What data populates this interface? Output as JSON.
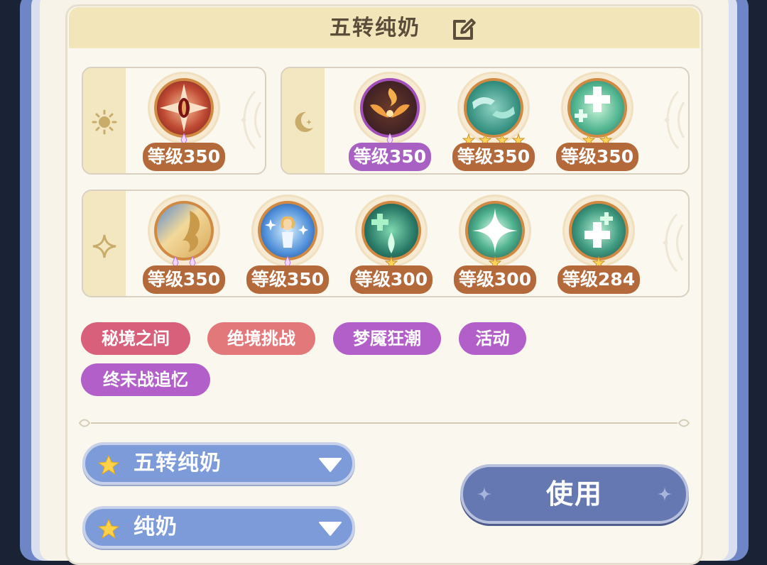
{
  "header": {
    "title": "五转纯奶"
  },
  "rows": [
    {
      "icon": "sun-icon",
      "skills": [
        {
          "name": "red-eye-skill",
          "level": "等级350",
          "style": "orange"
        }
      ]
    },
    {
      "icon": "moon-icon",
      "skills": [
        {
          "name": "flame-wings-skill",
          "level": "等级350",
          "style": "purple"
        },
        {
          "name": "healing-hands-skill",
          "level": "等级350",
          "style": "orange"
        },
        {
          "name": "green-cross-skill",
          "level": "等级350",
          "style": "orange"
        }
      ]
    },
    {
      "icon": "sparkle-icon",
      "skills": [
        {
          "name": "dragon-skill",
          "level": "等级350",
          "style": "orange"
        },
        {
          "name": "angel-skill",
          "level": "等级350",
          "style": "orange"
        },
        {
          "name": "heal-burst-skill",
          "level": "等级300",
          "style": "orange"
        },
        {
          "name": "star-burst-skill",
          "level": "等级300",
          "style": "orange"
        },
        {
          "name": "cross-burst-skill",
          "level": "等级284",
          "style": "orange"
        }
      ]
    }
  ],
  "tags": [
    {
      "label": "秘境之间",
      "color": "#d9607a"
    },
    {
      "label": "绝境挑战",
      "color": "#e2787a"
    },
    {
      "label": "梦魇狂潮",
      "color": "#b35fc9"
    },
    {
      "label": "活动",
      "color": "#b35fc9"
    },
    {
      "label": "终末战追忆",
      "color": "#b35fc9"
    }
  ],
  "dropdowns": [
    {
      "label": "五转纯奶"
    },
    {
      "label": "纯奶"
    }
  ],
  "use_button": {
    "label": "使用"
  },
  "colors": {
    "accent_blue": "#7d9ad9",
    "level_orange": "#b3693a",
    "level_purple": "#a861c2",
    "title_bar": "#f1e5b9"
  }
}
